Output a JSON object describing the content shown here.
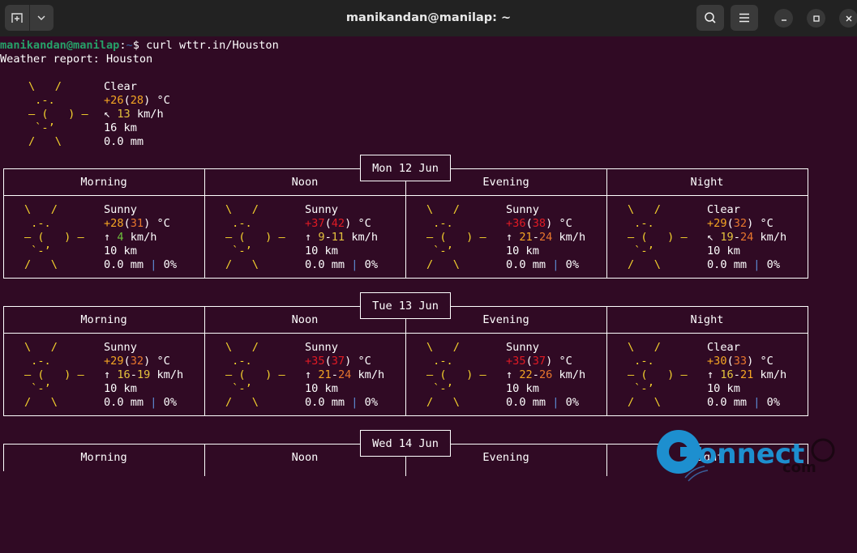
{
  "window": {
    "title": "manikandan@manilap: ~",
    "buttons": {
      "new_tab": "new-tab",
      "dropdown": "chevron-down",
      "search": "search",
      "menu": "menu",
      "minimize": "minimize",
      "maximize": "maximize",
      "close": "close"
    }
  },
  "terminal": {
    "prompt_user": "manikandan@manilap",
    "prompt_sep": ":",
    "prompt_path": "~",
    "prompt_symbol": "$",
    "command": "curl wttr.in/Houston",
    "report_title": "Weather report: Houston",
    "current": {
      "condition": "Clear",
      "temp": "+26",
      "feels": "28",
      "unit": "°C",
      "wind_arrow": "↖",
      "wind": "13",
      "wind_unit": "km/h",
      "visibility": "16 km",
      "precip": "0.0 mm"
    },
    "sun_art": [
      "\\   /",
      " .-.",
      "― (   ) ―",
      " `-’",
      "/   \\"
    ],
    "periods": [
      "Morning",
      "Noon",
      "Evening",
      "Night"
    ],
    "days": [
      {
        "date": "Mon 12 Jun",
        "slots": [
          {
            "condition": "Sunny",
            "temp": "+28",
            "feels": "31",
            "unit": "°C",
            "arrow": "↑",
            "wind": "4",
            "wind_unit": "km/h",
            "visibility": "10 km",
            "precip": "0.0 mm",
            "chance": "0%"
          },
          {
            "condition": "Sunny",
            "temp": "+37",
            "feels": "42",
            "unit": "°C",
            "arrow": "↑",
            "wind": "9-11",
            "wind_unit": "km/h",
            "visibility": "10 km",
            "precip": "0.0 mm",
            "chance": "0%"
          },
          {
            "condition": "Sunny",
            "temp": "+36",
            "feels": "38",
            "unit": "°C",
            "arrow": "↑",
            "wind": "21-24",
            "wind_unit": "km/h",
            "visibility": "10 km",
            "precip": "0.0 mm",
            "chance": "0%"
          },
          {
            "condition": "Clear",
            "temp": "+29",
            "feels": "32",
            "unit": "°C",
            "arrow": "↖",
            "wind": "19-24",
            "wind_unit": "km/h",
            "visibility": "10 km",
            "precip": "0.0 mm",
            "chance": "0%"
          }
        ]
      },
      {
        "date": "Tue 13 Jun",
        "slots": [
          {
            "condition": "Sunny",
            "temp": "+29",
            "feels": "32",
            "unit": "°C",
            "arrow": "↑",
            "wind": "16-19",
            "wind_unit": "km/h",
            "visibility": "10 km",
            "precip": "0.0 mm",
            "chance": "0%"
          },
          {
            "condition": "Sunny",
            "temp": "+35",
            "feels": "37",
            "unit": "°C",
            "arrow": "↑",
            "wind": "21-24",
            "wind_unit": "km/h",
            "visibility": "10 km",
            "precip": "0.0 mm",
            "chance": "0%"
          },
          {
            "condition": "Sunny",
            "temp": "+35",
            "feels": "37",
            "unit": "°C",
            "arrow": "↑",
            "wind": "22-26",
            "wind_unit": "km/h",
            "visibility": "10 km",
            "precip": "0.0 mm",
            "chance": "0%"
          },
          {
            "condition": "Clear",
            "temp": "+30",
            "feels": "33",
            "unit": "°C",
            "arrow": "↑",
            "wind": "16-21",
            "wind_unit": "km/h",
            "visibility": "10 km",
            "precip": "0.0 mm",
            "chance": "0%"
          }
        ]
      },
      {
        "date": "Wed 14 Jun",
        "slots": []
      }
    ]
  },
  "watermark": {
    "text": "onnect",
    "suffix": "com"
  }
}
